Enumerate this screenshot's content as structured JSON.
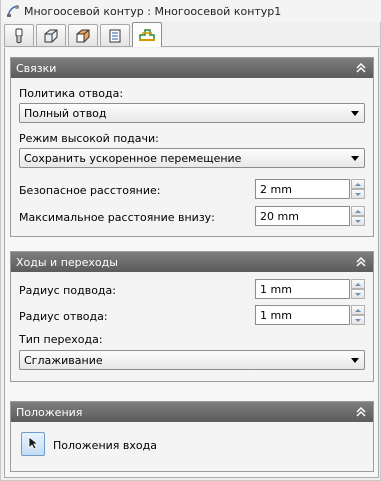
{
  "window": {
    "title": "Многоосевой контур : Многоосевой контур1"
  },
  "tabs": [
    {
      "icon": "tool-icon"
    },
    {
      "icon": "geometry-icon"
    },
    {
      "icon": "stock-icon"
    },
    {
      "icon": "passes-icon"
    },
    {
      "icon": "linking-icon",
      "active": true
    }
  ],
  "sections": {
    "links": {
      "title": "Связки",
      "retract_policy_label": "Политика отвода:",
      "retract_policy_value": "Полный отвод",
      "high_feed_label": "Режим высокой подачи:",
      "high_feed_value": "Сохранить ускоренное перемещение",
      "safe_distance_label": "Безопасное расстояние:",
      "safe_distance_value": "2 mm",
      "max_stay_down_label": "Максимальное расстояние внизу:",
      "max_stay_down_value": "20 mm"
    },
    "leads": {
      "title": "Ходы и переходы",
      "lead_in_radius_label": "Радиус подвода:",
      "lead_in_radius_value": "1 mm",
      "lead_out_radius_label": "Радиус отвода:",
      "lead_out_radius_value": "1 mm",
      "transition_type_label": "Тип перехода:",
      "transition_type_value": "Сглаживание"
    },
    "positions": {
      "title": "Положения",
      "entry_positions_label": "Положения входа"
    }
  }
}
